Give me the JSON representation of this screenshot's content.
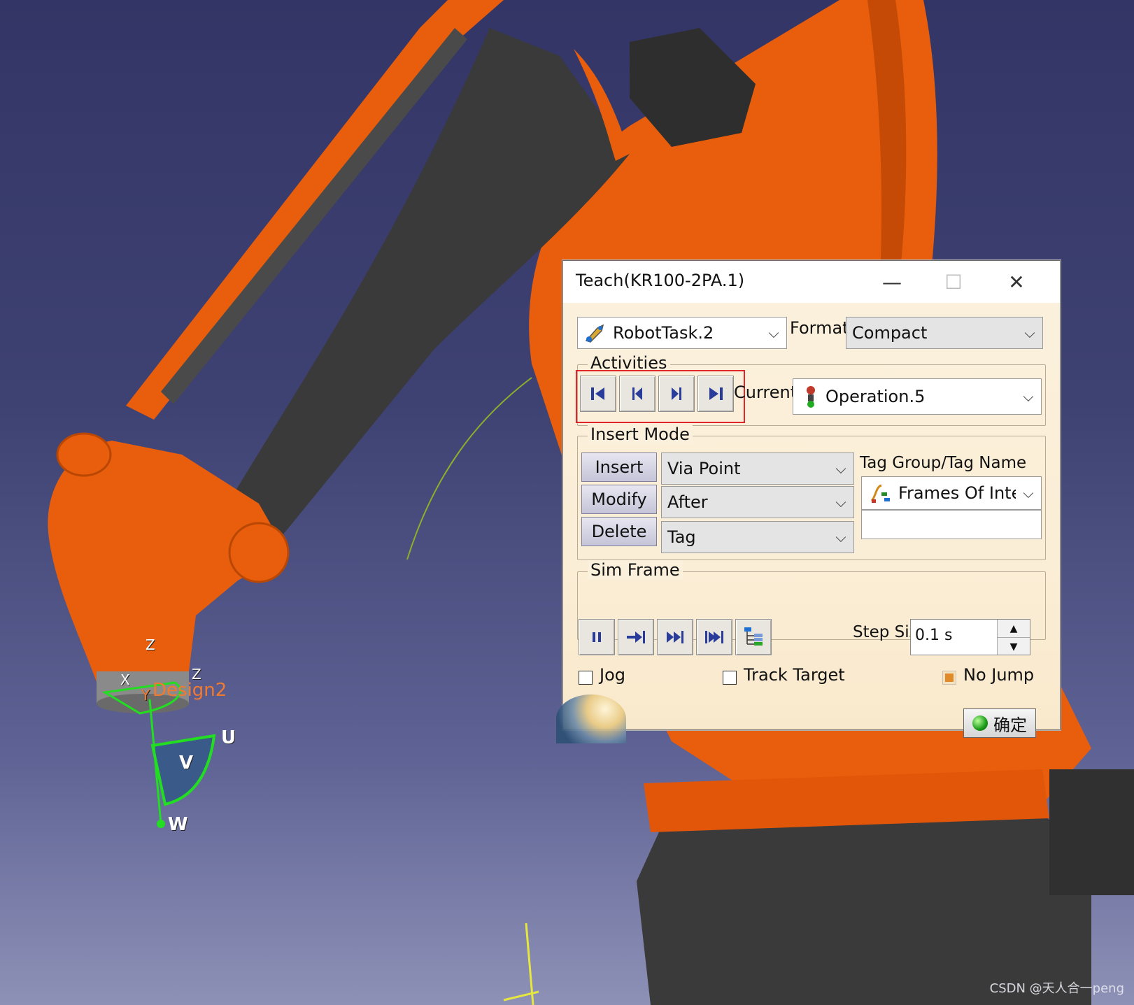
{
  "scene": {
    "labels": {
      "design": "Design2",
      "u": "U",
      "v": "V",
      "w": "W",
      "z1": "Z",
      "z2": "Z",
      "x": "X",
      "y": "Y"
    },
    "watermark": "CSDN @天人合一peng",
    "colors": {
      "robot_orange": "#e85e0c",
      "robot_dark": "#3b3b3b",
      "frame_green": "#22dd22"
    }
  },
  "dialog": {
    "title": "Teach(KR100-2PA.1)",
    "window_buttons": {
      "minimize": "—",
      "maximize": "☐",
      "close": "✕"
    },
    "task_select": {
      "value": "RobotTask.2"
    },
    "format_label": "Format",
    "format_select": {
      "value": "Compact"
    },
    "activities": {
      "title": "Activities",
      "nav_buttons": [
        "first-activity",
        "previous-activity",
        "next-activity",
        "last-activity"
      ],
      "current_label": "Current",
      "current_select": {
        "value": "Operation.5"
      }
    },
    "insert_mode": {
      "title": "Insert Mode",
      "insert_label": "Insert",
      "modify_label": "Modify",
      "delete_label": "Delete",
      "type_select": "Via Point",
      "position_select": "After",
      "tag_select": "Tag",
      "tag_group_label": "Tag Group/Tag Name",
      "tag_group_select": "Frames Of Inte"
    },
    "sim_frame": {
      "title": "Sim Frame",
      "step_size_label": "Step Size",
      "step_size_value": "0.1 s"
    },
    "jog_label": "Jog",
    "track_target_label": "Track Target",
    "no_jump_label": "No Jump",
    "ok_label": "确定"
  }
}
